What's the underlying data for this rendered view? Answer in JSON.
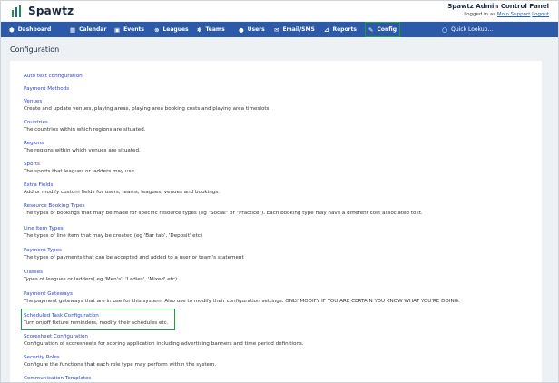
{
  "brand": {
    "name": "Spawtz"
  },
  "admin": {
    "title": "Spawtz Admin Control Panel",
    "logged_prefix": "Logged in as",
    "user": "Molo Support",
    "logout": "Logout"
  },
  "nav": {
    "items": [
      {
        "label": "Dashboard",
        "icon": "dashboard-icon"
      },
      {
        "label": "Calendar",
        "icon": "calendar-icon"
      },
      {
        "label": "Events",
        "icon": "events-icon"
      },
      {
        "label": "Leagues",
        "icon": "leagues-icon"
      },
      {
        "label": "Teams",
        "icon": "teams-icon"
      },
      {
        "label": "Users",
        "icon": "users-icon"
      },
      {
        "label": "Email/SMS",
        "icon": "email-icon"
      },
      {
        "label": "Reports",
        "icon": "reports-icon"
      },
      {
        "label": "Config",
        "icon": "config-icon"
      }
    ],
    "quick_lookup": "Quick Lookup..."
  },
  "page": {
    "title": "Configuration"
  },
  "entries": [
    {
      "title": "Auto text configuration",
      "desc": ""
    },
    {
      "title": "Payment Methods",
      "desc": ""
    },
    {
      "title": "Venues",
      "desc": "Create and update venues, playing areas, playing area booking costs and playing area timeslots."
    },
    {
      "title": "Countries",
      "desc": "The countries within which regions are situated."
    },
    {
      "title": "Regions",
      "desc": "The regions within which venues are situated."
    },
    {
      "title": "Sports",
      "desc": "The sports that leagues or ladders may use."
    },
    {
      "title": "Extra Fields",
      "desc": "Add or modify custom fields for users, teams, leagues, venues and bookings."
    },
    {
      "title": "Resource Booking Types",
      "desc": "The types of bookings that may be made for specific resource types (eg \"Social\" or \"Practice\"). Each booking type may have a different cost associated to it."
    },
    {
      "title": "Line Item Types",
      "desc": "The types of line item that may be created (eg 'Bar tab', 'Deposit' etc)"
    },
    {
      "title": "Payment Types",
      "desc": "The types of payments that can be accepted and added to a user or team's statement"
    },
    {
      "title": "Classes",
      "desc": "Types of leagues or ladders( eg 'Men's', 'Ladies', 'Mixed' etc)"
    },
    {
      "title": "Payment Gateways",
      "desc": "The payment gateways that are in use for this system. Also use to modify their configuration settings. ONLY MODIFY IF YOU ARE CERTAIN YOU KNOW WHAT YOU'RE DOING."
    },
    {
      "title": "Scheduled Task Configuration",
      "desc": "Turn on/off fixture reminders, modify their schedules etc."
    },
    {
      "title": "Scoresheet Configuration",
      "desc": "Configuration of scoresheets for scoring application including advertising banners and time period definitions."
    },
    {
      "title": "Security Roles",
      "desc": "Configure the functions that each role type may perform within the system."
    },
    {
      "title": "Communication Templates",
      "desc": ""
    }
  ],
  "colors": {
    "nav_bg": "#2d5aa8",
    "link": "#2c46c8",
    "highlight": "#1d9c3f"
  }
}
